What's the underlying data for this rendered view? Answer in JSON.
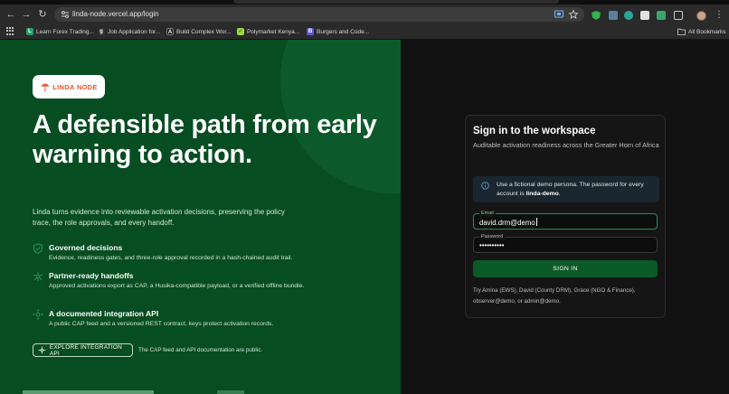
{
  "browser": {
    "url": "linda-node.vercel.app/login",
    "bookmarks": [
      {
        "label": "Learn Forex Trading...",
        "color": "#21a366",
        "glyph": "L"
      },
      {
        "label": "Job Application for...",
        "color": "#2f2f2f",
        "glyph": "g"
      },
      {
        "label": "Build Complex Wor...",
        "color": "#1b1b1b",
        "glyph": "A"
      },
      {
        "label": "Polymarket Kenya...",
        "color": "#9ad93b",
        "glyph": "✓"
      },
      {
        "label": "Burgers and Code...",
        "color": "#5b5bd6",
        "glyph": "B"
      }
    ],
    "all_bookmarks_label": "All Bookmarks"
  },
  "hero": {
    "logo_text": "LINDA NODE",
    "headline": "A defensible path from early warning to action.",
    "lead": "Linda turns evidence into reviewable activation decisions, preserving the policy trace, the role approvals, and every handoff.",
    "features": [
      {
        "title": "Governed decisions",
        "desc": "Evidence, readiness gates, and three-role approval recorded in a hash-chained audit trail."
      },
      {
        "title": "Partner-ready handoffs",
        "desc": "Approved activations export as CAP, a Husika-compatible payload, or a verified offline bundle."
      },
      {
        "title": "A documented integration API",
        "desc": "A public CAP feed and a versioned REST contract, keys protect activation records."
      }
    ],
    "explore_label": "EXPLORE INTEGRATION API",
    "explore_note": "The CAP feed and API documentation are public."
  },
  "signin": {
    "title": "Sign in to the workspace",
    "subtitle": "Auditable activation readiness across the Greater Horn of Africa",
    "notice_prefix": "Use a fictional demo persona. The password for every account is ",
    "notice_password": "linda-demo",
    "notice_suffix": ".",
    "email_label": "Email",
    "email_value": "david.drm@demo",
    "password_label": "Password",
    "password_value": "••••••••••",
    "submit_label": "SIGN IN",
    "demo_hint": "Try Amina (EWS), David (County DRM), Grace (NGO & Finance), observer@demo, or admin@demo."
  },
  "colors": {
    "hero_bg": "#064d22",
    "button_green": "#0a5a27",
    "accent_orange": "#e8542a"
  }
}
